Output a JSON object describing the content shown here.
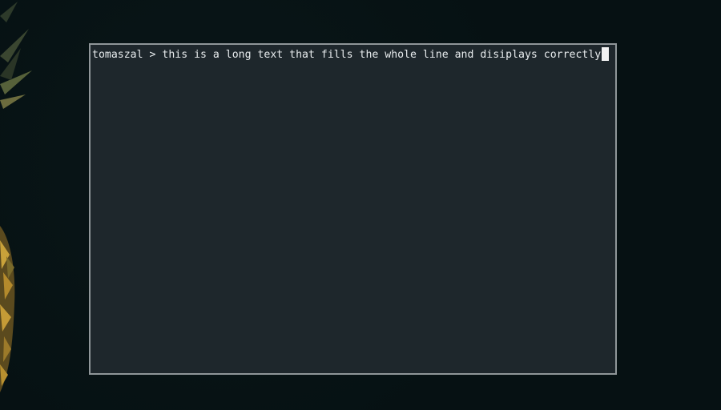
{
  "terminal": {
    "prompt_user": "tomaszal",
    "prompt_symbol": ">",
    "command_text": "this is a long text that fills the whole line and disiplays correctly"
  },
  "colors": {
    "wallpaper": "#061113",
    "terminal_background": "#1e272c",
    "terminal_border": "#8f9699",
    "text": "#e8ecee",
    "cursor": "#f2f2f2"
  },
  "icons": {
    "cursor": "block-cursor-icon"
  }
}
